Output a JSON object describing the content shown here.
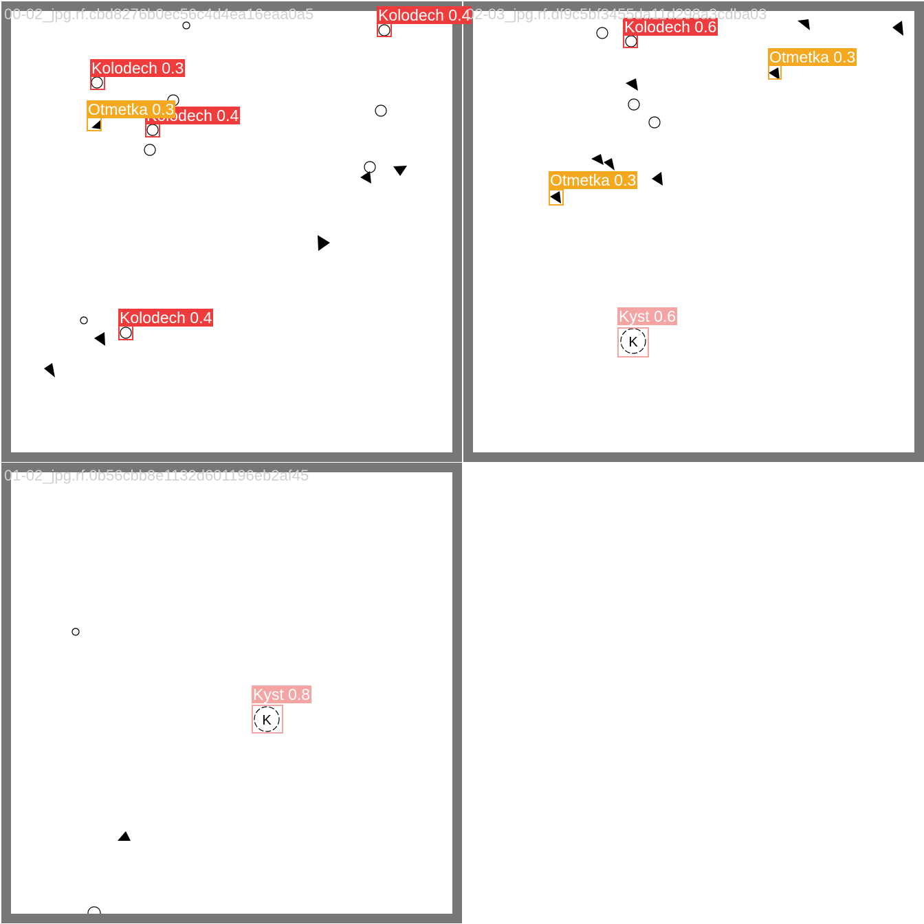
{
  "tiles": [
    {
      "title": "00-02_jpg.rf.cbd8276b0ec56c4d4ea16eaa0a5",
      "detections": [
        {
          "label": "Kolodech 0.4"
        },
        {
          "label": "Kolodech 0.3"
        },
        {
          "label": "Otmetka 0.3"
        },
        {
          "label": "Kolodech 0.4"
        },
        {
          "label": "Kolodech 0.4"
        }
      ]
    },
    {
      "title": "02-03_jpg.rf.df9c5bf3455da11d298a3cdba03",
      "detections": [
        {
          "label": "Kolodech 0.6"
        },
        {
          "label": "Otmetka 0.3"
        },
        {
          "label": "Otmetka 0.3"
        },
        {
          "label": "Kyst 0.6"
        }
      ],
      "symbol_letter": "K"
    },
    {
      "title": "01-02_jpg.rf.0b56cbb8e1132d601196eb2af45",
      "detections": [
        {
          "label": "Kyst 0.8"
        }
      ],
      "symbol_letter": "K"
    }
  ],
  "colors": {
    "frame": "#777777",
    "kolodech": "#ef3b3b",
    "otmetka": "#f3a81f",
    "kyst": "#f5a4a4"
  }
}
